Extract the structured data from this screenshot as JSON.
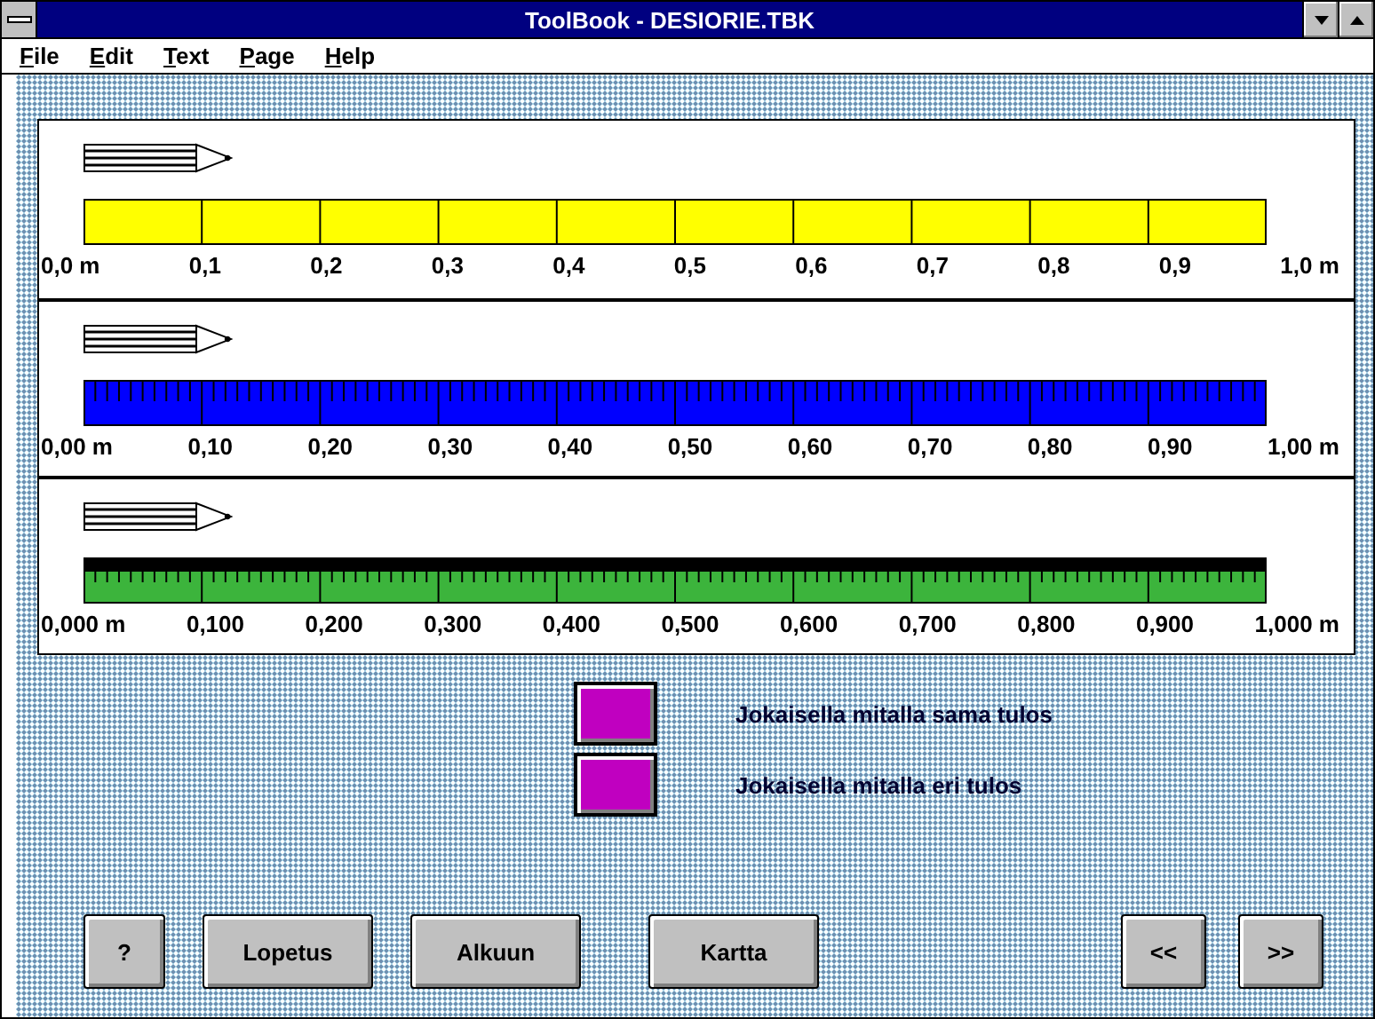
{
  "window": {
    "title": "ToolBook - DESIORIE.TBK"
  },
  "menu": [
    "File",
    "Edit",
    "Text",
    "Page",
    "Help"
  ],
  "rulers": [
    {
      "kind": "plain",
      "color": "#ffff00",
      "labels": [
        "0,0 m",
        "0,1",
        "0,2",
        "0,3",
        "0,4",
        "0,5",
        "0,6",
        "0,7",
        "0,8",
        "0,9",
        "1,0 m"
      ]
    },
    {
      "kind": "ticked",
      "color": "#0000ff",
      "labels": [
        "0,00 m",
        "0,10",
        "0,20",
        "0,30",
        "0,40",
        "0,50",
        "0,60",
        "0,70",
        "0,80",
        "0,90",
        "1,00 m"
      ]
    },
    {
      "kind": "banded",
      "color": "#3cb43c",
      "labels": [
        "0,000 m",
        "0,100",
        "0,200",
        "0,300",
        "0,400",
        "0,500",
        "0,600",
        "0,700",
        "0,800",
        "0,900",
        "1,000 m"
      ]
    }
  ],
  "answers": [
    {
      "label": "Jokaisella mitalla sama tulos"
    },
    {
      "label": "Jokaisella mitalla eri tulos"
    }
  ],
  "buttons_left": [
    "?",
    "Lopetus",
    "Alkuun",
    "Kartta"
  ],
  "buttons_right": [
    "<<",
    ">>"
  ]
}
